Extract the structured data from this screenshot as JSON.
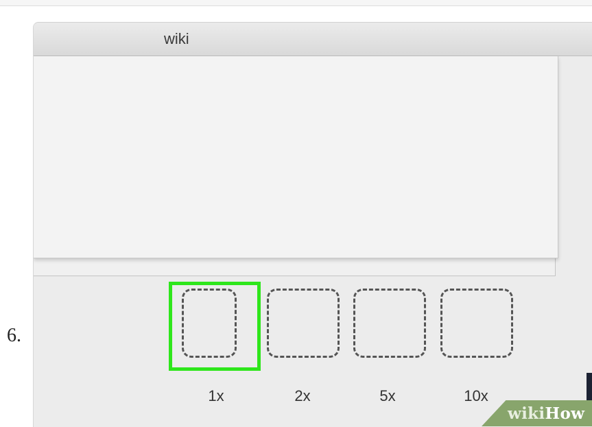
{
  "step": {
    "number": "6."
  },
  "window": {
    "title": "wiki"
  },
  "presets": [
    {
      "label": "1x",
      "selected": true
    },
    {
      "label": "2x",
      "selected": false
    },
    {
      "label": "5x",
      "selected": false
    },
    {
      "label": "10x",
      "selected": false
    }
  ],
  "highlight_color": "#2ee61b",
  "watermark": {
    "text_a": "wiki",
    "text_b": "How"
  }
}
